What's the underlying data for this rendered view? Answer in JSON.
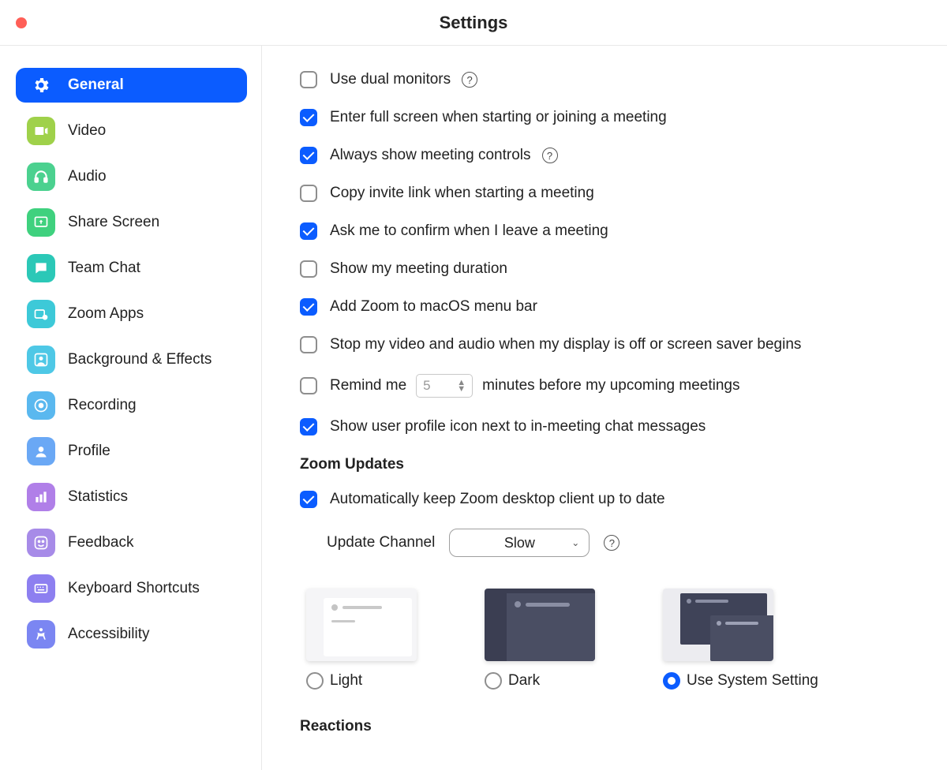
{
  "title": "Settings",
  "sidebar": {
    "items": [
      {
        "label": "General"
      },
      {
        "label": "Video"
      },
      {
        "label": "Audio"
      },
      {
        "label": "Share Screen"
      },
      {
        "label": "Team Chat"
      },
      {
        "label": "Zoom Apps"
      },
      {
        "label": "Background & Effects"
      },
      {
        "label": "Recording"
      },
      {
        "label": "Profile"
      },
      {
        "label": "Statistics"
      },
      {
        "label": "Feedback"
      },
      {
        "label": "Keyboard Shortcuts"
      },
      {
        "label": "Accessibility"
      }
    ]
  },
  "general": {
    "dual_monitors": "Use dual monitors",
    "full_screen": "Enter full screen when starting or joining a meeting",
    "always_controls": "Always show meeting controls",
    "copy_invite": "Copy invite link when starting a meeting",
    "confirm_leave": "Ask me to confirm when I leave a meeting",
    "show_duration": "Show my meeting duration",
    "menu_bar": "Add Zoom to macOS menu bar",
    "stop_av": "Stop my video and audio when my display is off or screen saver begins",
    "remind_pre": "Remind me",
    "remind_val": "5",
    "remind_post": "minutes before my upcoming meetings",
    "show_profile": "Show user profile icon next to in-meeting chat messages"
  },
  "updates": {
    "heading": "Zoom Updates",
    "auto": "Automatically keep Zoom desktop client up to date",
    "channel_label": "Update Channel",
    "channel_value": "Slow"
  },
  "themes": {
    "light": "Light",
    "dark": "Dark",
    "system": "Use System Setting"
  },
  "reactions_heading": "Reactions"
}
